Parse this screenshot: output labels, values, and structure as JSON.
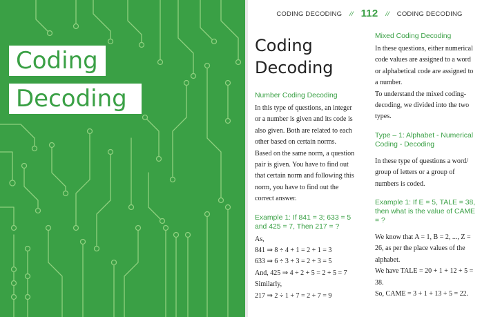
{
  "left": {
    "title_line1": "Coding",
    "title_line2": "Decoding",
    "colors": {
      "background": "#3aa045",
      "circuit": "#8fd07f"
    }
  },
  "header": {
    "left_text": "CODING DECODING",
    "separator": "//",
    "page_number": "112",
    "right_text": "CODING DECODING"
  },
  "col1": {
    "title_line1": "Coding",
    "title_line2": "Decoding",
    "section_heading": "Number Coding Decoding",
    "intro_lines": [
      "In this type of questions, an integer",
      "or a number is given and its code is",
      "also given. Both are related to each",
      "other based on certain norms.",
      "Based on the same norm, a question",
      "pair is given. You have to find out",
      "that certain norm and following this",
      "norm, you have to find out the",
      "correct answer."
    ],
    "example_heading_lines": [
      "Example 1: If 841 = 3; 633 = 5",
      "and 425 = 7, Then 217 = ?"
    ],
    "solution_lines": [
      "As,",
      "841 ⇒ 8 ÷ 4 + 1 = 2 + 1 = 3",
      "633 ⇒ 6 ÷ 3 + 3 = 2 + 3 = 5",
      "And, 425 ⇒ 4 ÷ 2 + 5 = 2 + 5 = 7",
      "Similarly,",
      "217 ⇒ 2 ÷ 1 + 7 = 2 + 7 = 9"
    ]
  },
  "col2": {
    "section_heading": "Mixed Coding Decoding",
    "intro_lines": [
      "In these questions, either numerical",
      "code values are assigned to a word",
      "or alphabetical code are assigned to",
      "a number.",
      "To understand the mixed coding-",
      "decoding, we divided into the two",
      "types."
    ],
    "type_heading_lines": [
      "Type – 1: Alphabet - Numerical",
      "Coding - Decoding"
    ],
    "type_lines": [
      "In these type of questions a word/",
      "group of letters or a group of",
      "numbers is coded."
    ],
    "example_heading_lines": [
      "Example 1: If E = 5, TALE = 38,",
      "then what is the value of CAME",
      "= ?"
    ],
    "solution_lines": [
      "We know that A = 1, B = 2, ..., Z =",
      "26, as per the place values of the",
      "alphabet.",
      "We have TALE = 20 + 1 + 12 + 5 =",
      "38.",
      "So, CAME = 3 + 1 + 13 + 5 = 22."
    ]
  }
}
